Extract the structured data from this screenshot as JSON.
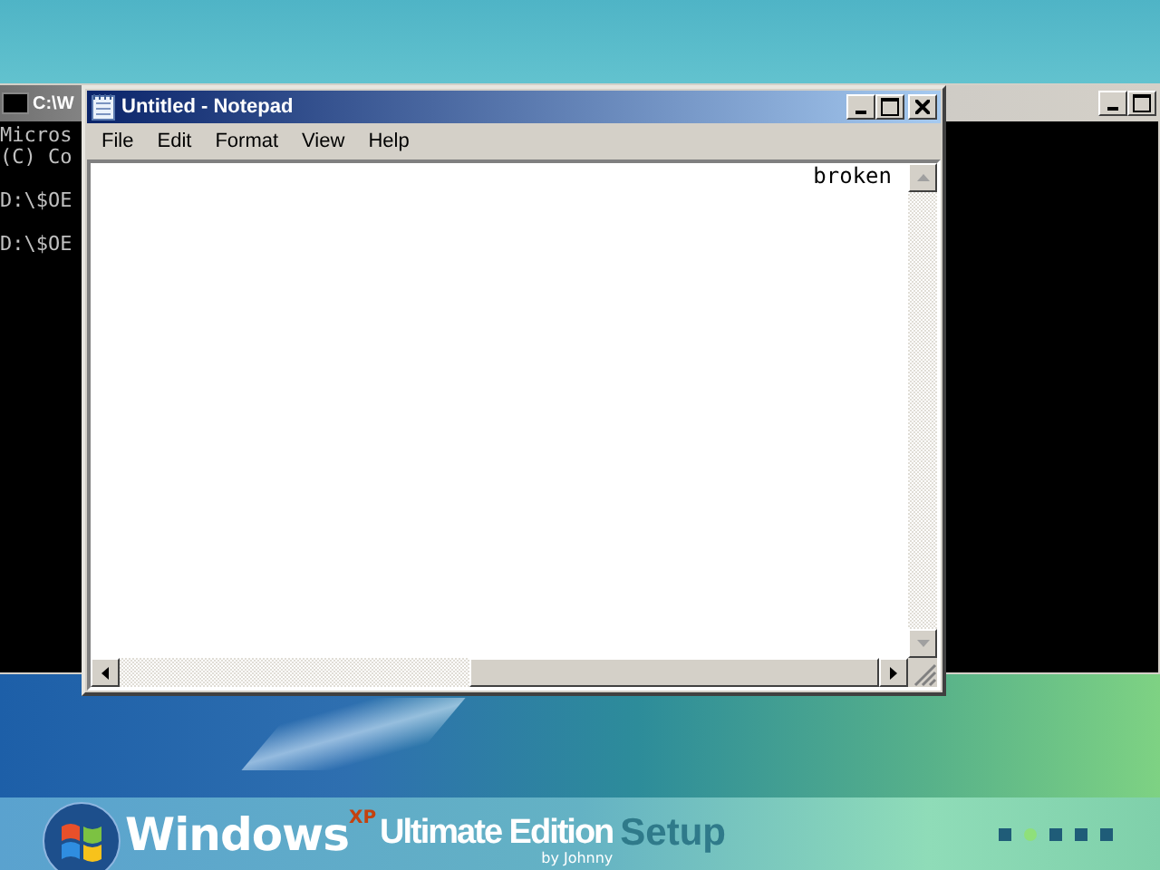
{
  "console": {
    "title": "C:\\W",
    "blocks": [
      [
        "Micros",
        "(C) Co"
      ],
      [
        "D:\\$OE"
      ],
      [
        "D:\\$OE"
      ]
    ]
  },
  "notepad": {
    "title": "Untitled - Notepad",
    "menu": [
      "File",
      "Edit",
      "Format",
      "View",
      "Help"
    ],
    "text": "broken"
  },
  "banner": {
    "brand": "Windows",
    "superscript": "XP",
    "edition": "Ultimate Edition",
    "byline": "by Johnny",
    "suffix": "Setup"
  },
  "progress_steps": [
    {
      "selected": false
    },
    {
      "selected": true
    },
    {
      "selected": false
    },
    {
      "selected": false
    },
    {
      "selected": false
    }
  ]
}
